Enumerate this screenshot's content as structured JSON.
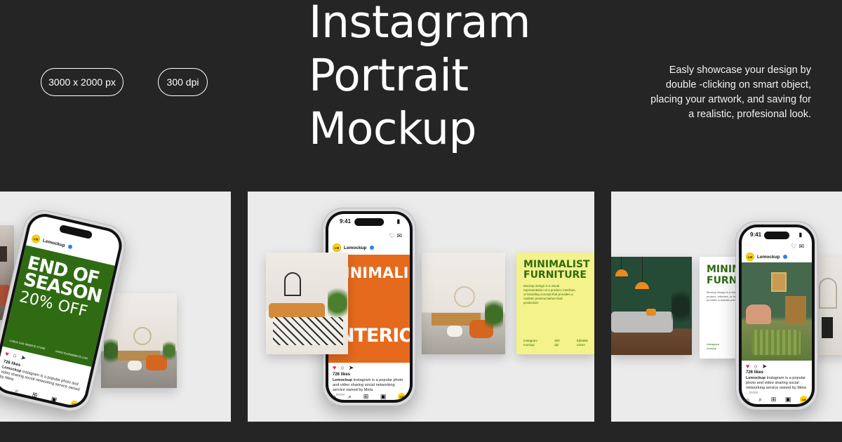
{
  "header": {
    "size_pill": "3000 x 2000 px",
    "dpi_pill": "300 dpi",
    "title_lines": [
      "Instagram",
      "Portrait",
      "Mockup"
    ],
    "description_lines": [
      "Easly showcase your design by",
      "double -clicking on smart object,",
      "placing your artwork, and saving for",
      "a realistic, profesional look."
    ]
  },
  "phone_ui": {
    "time": "9:41",
    "username": "Lemockup",
    "avatar_initials": "LM",
    "likes": "726 likes",
    "caption_user": "Lemockup",
    "caption_text": "Instagram is a popular photo and video sharing social networking service owned by Meta",
    "more": "...more"
  },
  "panel1": {
    "post_line1": "END OF",
    "post_line2": "SEASON",
    "post_line3": "20% OFF",
    "post_footer_left": "CHECK OUR WEBSITE STORE",
    "post_footer_right": "WWW.YOURWEBSITE.COM"
  },
  "panel2": {
    "post_top": "MINIMALIST",
    "post_bottom": "INTERIOR",
    "yellow_title_1": "MINIMALIST",
    "yellow_title_2": "FURNITURE",
    "yellow_body": "Mockup design is a visual representation of a product, interface, or branding concept that provides a realistic preview before final production.",
    "yellow_foot_1a": "Instagram",
    "yellow_foot_1b": "mockup",
    "yellow_foot_2a": "300",
    "yellow_foot_2b": "dpi",
    "yellow_foot_3a": "Editable",
    "yellow_foot_3b": "colors"
  },
  "panel3": {
    "card_title_1": "MINIMALIST",
    "card_title_2": "FURNITURE",
    "card_body": "Mockup design is a visual representation of a product, interface, or branding concept that provides a realistic preview before final production.",
    "card_foot_a": "Instagram",
    "card_foot_b": "mockup"
  },
  "colors": {
    "background": "#252525",
    "panel": "#ebebeb",
    "brand_green": "#2f6b12",
    "brand_orange": "#e56a1d",
    "brand_yellow": "#f4f28a",
    "avatar_yellow": "#ffd400"
  }
}
